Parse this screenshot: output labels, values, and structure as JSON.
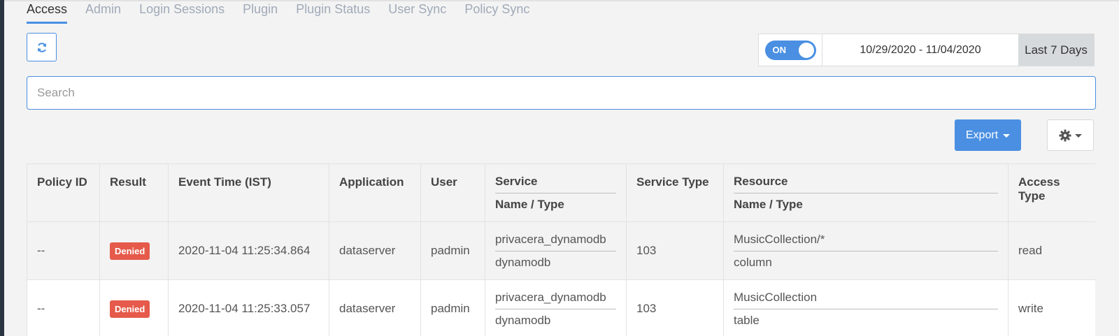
{
  "tabs": [
    {
      "label": "Access",
      "active": true
    },
    {
      "label": "Admin"
    },
    {
      "label": "Login Sessions"
    },
    {
      "label": "Plugin"
    },
    {
      "label": "Plugin Status"
    },
    {
      "label": "User Sync"
    },
    {
      "label": "Policy Sync"
    }
  ],
  "toolbar": {
    "refresh_icon": "refresh-icon",
    "toggle_label": "ON",
    "date_range": "10/29/2020 - 11/04/2020",
    "range_label": "Last 7 Days"
  },
  "search": {
    "placeholder": "Search",
    "value": ""
  },
  "actions": {
    "export_label": "Export",
    "settings_icon": "gear-icon"
  },
  "colors": {
    "accent": "#4a8fe2",
    "denied": "#e55a4a"
  },
  "table": {
    "headers": {
      "policy_id": "Policy ID",
      "result": "Result",
      "event_time": "Event Time (IST)",
      "application": "Application",
      "user": "User",
      "service_top": "Service",
      "service_bottom": "Name / Type",
      "service_type": "Service Type",
      "resource_top": "Resource",
      "resource_bottom": "Name / Type",
      "access_type": "Access Type"
    },
    "rows": [
      {
        "policy_id": "--",
        "result": "Denied",
        "event_time": "2020-11-04 11:25:34.864",
        "application": "dataserver",
        "user": "padmin",
        "service_name": "privacera_dynamodb",
        "service_kind": "dynamodb",
        "service_type": "103",
        "resource_name": "MusicCollection/*",
        "resource_kind": "column",
        "access_type": "read"
      },
      {
        "policy_id": "--",
        "result": "Denied",
        "event_time": "2020-11-04 11:25:33.057",
        "application": "dataserver",
        "user": "padmin",
        "service_name": "privacera_dynamodb",
        "service_kind": "dynamodb",
        "service_type": "103",
        "resource_name": "MusicCollection",
        "resource_kind": "table",
        "access_type": "write"
      }
    ]
  }
}
